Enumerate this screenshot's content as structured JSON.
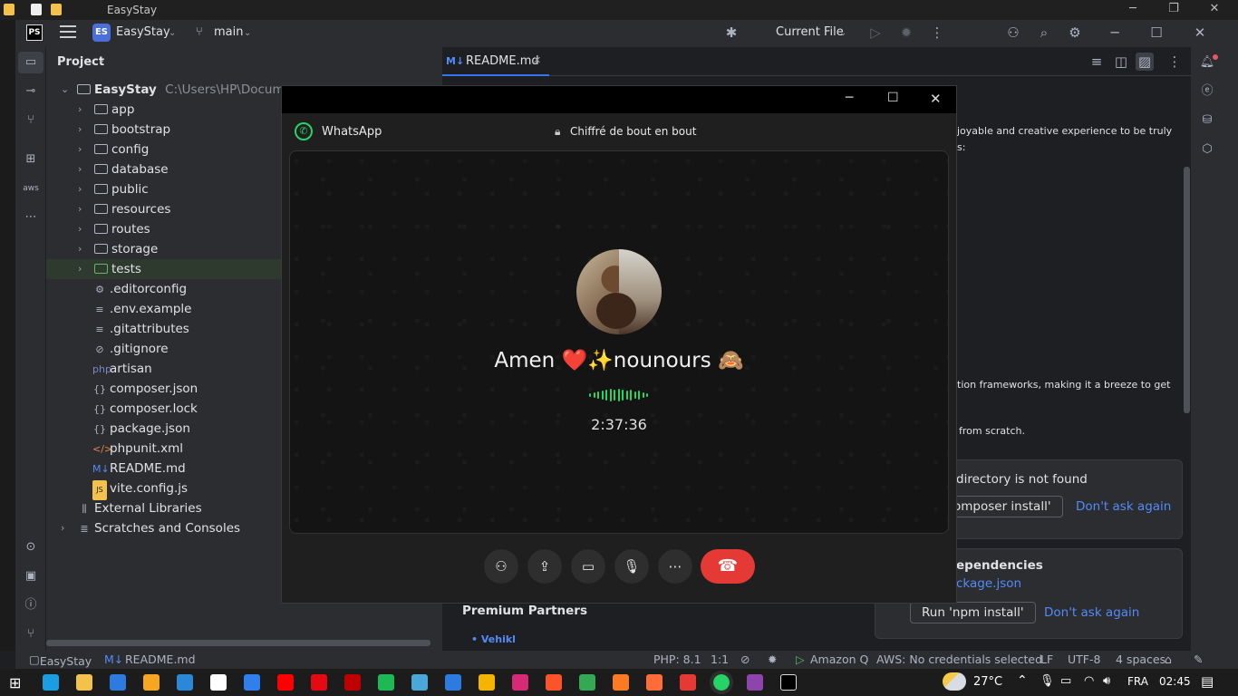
{
  "os": {
    "window_title": "EasyStay"
  },
  "ide": {
    "project_name": "EasyStay",
    "project_badge": "ES",
    "logo_text": "PS",
    "branch": "main",
    "run_config": "Current File",
    "project_panel_title": "Project",
    "tree": {
      "root_name": "EasyStay",
      "root_path": "C:\\Users\\HP\\Documen",
      "folders": [
        "app",
        "bootstrap",
        "config",
        "database",
        "public",
        "resources",
        "routes",
        "storage",
        "tests"
      ],
      "files": [
        {
          "name": ".editorconfig",
          "icon": "⚙"
        },
        {
          "name": ".env.example",
          "icon": "≡"
        },
        {
          "name": ".gitattributes",
          "icon": "≡"
        },
        {
          "name": ".gitignore",
          "icon": "⊘"
        },
        {
          "name": "artisan",
          "icon": "php"
        },
        {
          "name": "composer.json",
          "icon": "{}"
        },
        {
          "name": "composer.lock",
          "icon": "{}"
        },
        {
          "name": "package.json",
          "icon": "{}"
        },
        {
          "name": "phpunit.xml",
          "icon": "</>"
        },
        {
          "name": "README.md",
          "icon": "M↓"
        },
        {
          "name": "vite.config.js",
          "icon": "JS"
        }
      ],
      "external_libraries": "External Libraries",
      "scratches": "Scratches and Consoles"
    },
    "editor_tab": "README.md",
    "editor_fragments": {
      "line1": "joyable and creative experience to be truly",
      "line2": "s:",
      "line3": "tion frameworks, making it a breeze to get",
      "line4": "from scratch.",
      "premium": "Premium Partners",
      "vehikl": "Vehikl"
    },
    "notifications": {
      "n1_title": "directory is not found",
      "n1_button": "omposer install'",
      "n1_link": "Don't ask again",
      "n2_title": "ependencies",
      "n2_file": "ckage.json",
      "n2_button": "Run 'npm install'",
      "n2_link": "Don't ask again"
    },
    "status": {
      "project": "EasyStay",
      "file": "README.md",
      "php": "PHP: 8.1",
      "ratio": "1:1",
      "amazonq": "Amazon Q",
      "aws": "AWS: No credentials selected",
      "lf": "LF",
      "encoding": "UTF-8",
      "indent": "4 spaces"
    }
  },
  "whatsapp": {
    "app_name": "WhatsApp",
    "encryption_label": "Chiffré de bout en bout",
    "contact_name": "Amen ❤️✨nounours 🙈",
    "call_duration": "2:37:36",
    "accent_color": "#25d366",
    "end_call_color": "#e53935"
  },
  "taskbar": {
    "weather_temp": "27°C",
    "language": "FRA",
    "time": "02:45"
  }
}
